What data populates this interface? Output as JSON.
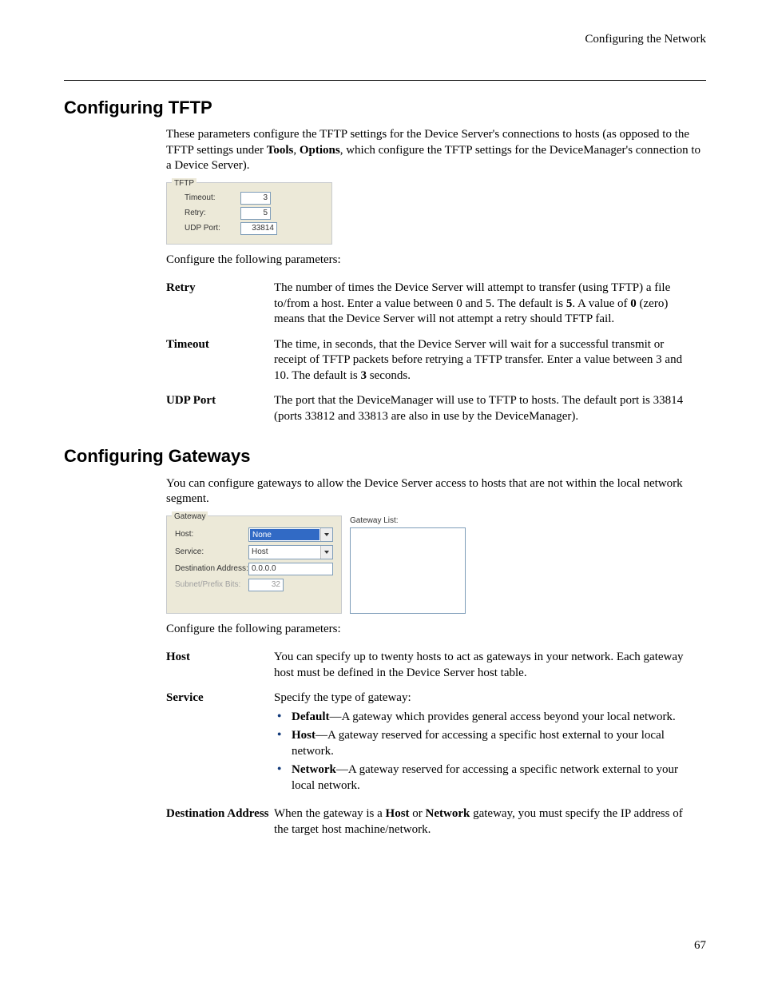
{
  "running_header": "Configuring the Network",
  "page_number": "67",
  "tftp": {
    "heading": "Configuring TFTP",
    "intro_pre": "These parameters configure the TFTP settings for the Device Server's connections to hosts (as opposed to the TFTP settings under ",
    "intro_bold1": "Tools",
    "intro_sep": ", ",
    "intro_bold2": "Options",
    "intro_post": ", which configure the TFTP settings for the DeviceManager's connection to a Device Server).",
    "figure": {
      "legend": "TFTP",
      "rows": {
        "timeout": {
          "label": "Timeout:",
          "value": "3"
        },
        "retry": {
          "label": "Retry:",
          "value": "5"
        },
        "udpport": {
          "label": "UDP Port:",
          "value": "33814"
        }
      }
    },
    "configure_line": "Configure the following parameters:",
    "params": {
      "retry": {
        "name": "Retry",
        "d1": "The number of times the Device Server will attempt to transfer (using TFTP) a file to/from a host. Enter a value between 0 and 5. The default is ",
        "b1": "5",
        "d2": ". A value of ",
        "b2": "0",
        "d3": " (zero) means that the Device Server will not attempt a retry should TFTP fail."
      },
      "timeout": {
        "name": "Timeout",
        "d1": "The time, in seconds, that the Device Server will wait for a successful transmit or receipt of TFTP packets before retrying a TFTP transfer. Enter a value between 3 and 10. The default is ",
        "b1": "3",
        "d2": " seconds."
      },
      "udpport": {
        "name": "UDP Port",
        "desc": "The port that the DeviceManager will use to TFTP to hosts. The default port is 33814 (ports 33812 and 33813 are also in use by the DeviceManager)."
      }
    }
  },
  "gateways": {
    "heading": "Configuring Gateways",
    "intro": "You can configure gateways to allow the Device Server access to hosts that are not within the local network segment.",
    "figure": {
      "legend": "Gateway",
      "host_label": "Host:",
      "host_value": "None",
      "service_label": "Service:",
      "service_value": "Host",
      "dest_label": "Destination Address:",
      "dest_value": "0.0.0.0",
      "subnet_label": "Subnet/Prefix Bits:",
      "subnet_value": "32",
      "list_label": "Gateway List:"
    },
    "configure_line": "Configure the following parameters:",
    "params": {
      "host": {
        "name": "Host",
        "desc": "You can specify up to twenty hosts to act as gateways in your network. Each gateway host must be defined in the Device Server host table."
      },
      "service": {
        "name": "Service",
        "intro": "Specify the type of gateway:",
        "items": {
          "default": {
            "b": "Default",
            "t": "—A gateway which provides general access beyond your local network."
          },
          "host": {
            "b": "Host",
            "t": "—A gateway reserved for accessing a specific host external to your local network."
          },
          "network": {
            "b": "Network",
            "t": "—A gateway reserved for accessing a specific network external to your local network."
          }
        }
      },
      "dest": {
        "name": "Destination Address",
        "d1": "When the gateway is a ",
        "b1": "Host",
        "d2": " or ",
        "b2": "Network",
        "d3": " gateway, you must specify the IP address of the target host machine/network."
      }
    }
  }
}
